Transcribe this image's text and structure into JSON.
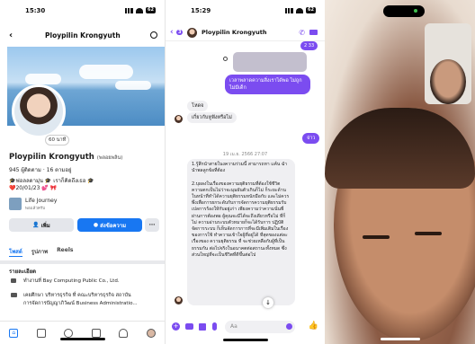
{
  "status1": {
    "time": "15:30",
    "battery": "62"
  },
  "status2": {
    "time": "15:29",
    "battery": "62"
  },
  "profile": {
    "header_name": "Ploypilin Krongyuth",
    "name": "Ploypilin Krongyuth",
    "alt_name": "(พลอยพลิน)",
    "followers": "945 ผู้ติดตาม",
    "following": "· 16 ตามอยู่",
    "bio1": "🎓ฟอลลดามุ่น 🎓 เราก็คิดถึงเธอ 🎓",
    "bio2": "❤️20/01/23 💕 🎀",
    "badge": "60 นาที",
    "journey_title": "Life Journey",
    "journey_sub": "พอแล้วครับ",
    "add_friend": "เพิ่ม",
    "message": "ส่งข้อความ",
    "more": "···",
    "tabs": [
      "โพสต์",
      "รูปภาพ",
      "Reels"
    ],
    "details_title": "รายละเอียด",
    "detail1": "ทำงานที่ Bay Computing Public Co., Ltd.",
    "detail2": "เคยศึกษา บริหารธุรกิจ ที่ คณะบริหารธุรกิจ สถาบัน",
    "detail3": "การจัดการปัญญาภิวัฒน์ Business Administratio..."
  },
  "chat": {
    "name": "Ploypilin Krongyuth",
    "back_count": "3",
    "msg_top_time": "2 33",
    "msg_out1": "เวลาพลาดความสิ่งเราได้พอ ไม่ถูก ไม่มีเด็ก",
    "msg_in1": "โหดจ",
    "msg_in2": "เกี่ยวกับหูฟังหรือไม่",
    "msg_out2": "จ่าว",
    "timestamp": "19 เม.ย. 2566 27:07",
    "long_msg": "1.รู้สึกนำสายในงความร่วมนี้ สามารถหา แค้น ฉำ นำพลลูกข้อที่ต้อง\n\n2.บุผลงในเรื่องของความยุติธรรมที่ต้องใช้ชีวิตความตกเป็นไม่ว่าจะมุมผันตัวเกินก็ไม่ ก็ระยะด้านในหน้าที่ทำได้ความยุติธรรมหนักมือกับ และไม่ควรพึ่งเพื่อการยกระดับกับการจัดการความยุติธรรมรับเปลการร้องให้กับอยู่เก่า เพียงความว่าความนั่นพี่ผ่านการต้องพอ ผู้คุณจะมีได้จะถึงเดียวหรือไม่ ที่ก็ไม่ ความอ่านระบบตัวหมายก็จะได้รับการ ปฏิบัติจัดการระบบ ก็เห็นจัดการการที่จะมีเพิ่มเติมในเรื่องของการใช้ ทำความเข้าใจผู้ที่อยู่ได้ ที่สุดของแต่ละเรื่องของ ความยุติธรรม ที่ จะช่วยเหลือกับผู้ที่เป็นธรรมกัน ต่อไปจริงในอนาคตต่อสถานะทั้งหมด ซึ่งส่วนใหญ่ที่จะเป็นชีวิตที่ดีขึ้นต่อไป",
    "input_placeholder": "Aa"
  },
  "call": {}
}
